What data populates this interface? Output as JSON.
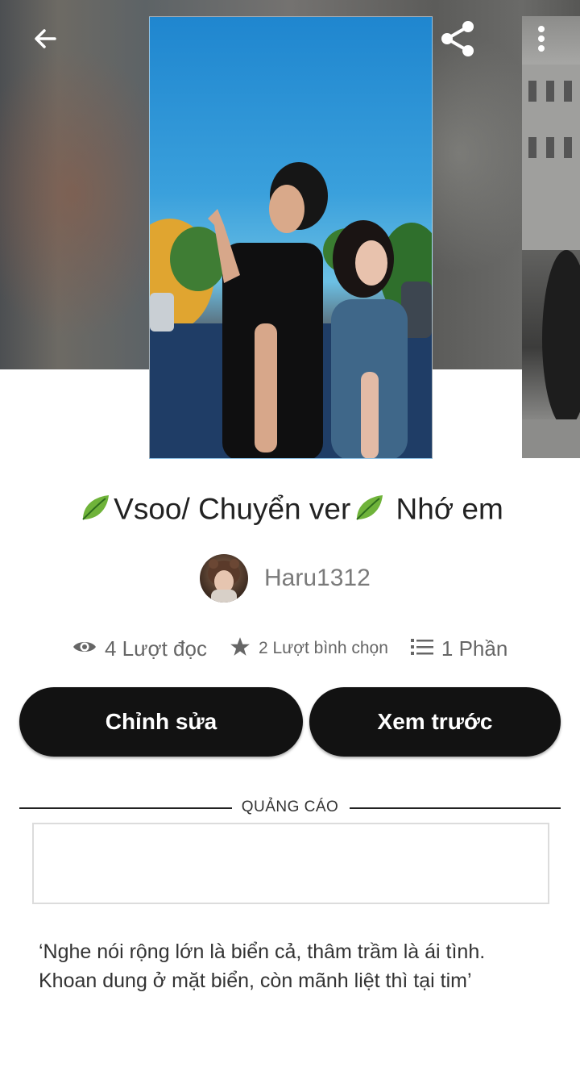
{
  "header": {
    "back_icon": "arrow-left-icon",
    "share_icon": "share-icon",
    "more_icon": "more-vertical-icon"
  },
  "story": {
    "title_part1": "Vsoo/ Chuyển ver",
    "title_part2": " Nhớ em",
    "leaf_icon": "leaf-emoji-icon",
    "author": "Haru1312",
    "stats": {
      "reads": "4 Lượt đọc",
      "votes": "2 Lượt bình chọn",
      "parts": "1 Phần"
    },
    "description_line1": "‘Nghe nói rộng lớn là biển cả, thâm trầm là ái tình.",
    "description_line2": "Khoan dung ở mặt biển, còn mãnh liệt thì tại tim’"
  },
  "buttons": {
    "edit": "Chỉnh sửa",
    "preview": "Xem trước"
  },
  "ad": {
    "label": "QUẢNG CÁO"
  },
  "colors": {
    "button_bg": "#121212",
    "stat_text": "#666666",
    "author_text": "#7a7a7a"
  }
}
